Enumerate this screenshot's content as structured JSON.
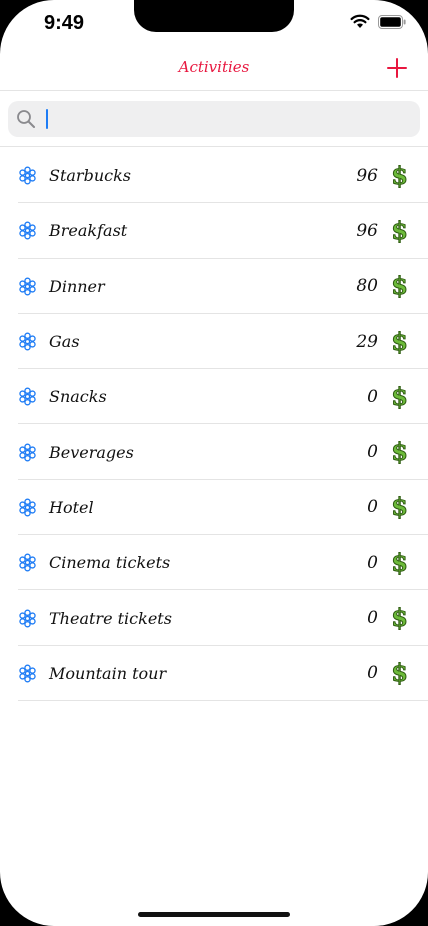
{
  "status_bar": {
    "time": "9:49"
  },
  "nav": {
    "title": "Activities",
    "add_icon": "plus-icon"
  },
  "search": {
    "value": "",
    "placeholder": "",
    "icon": "search-icon"
  },
  "colors": {
    "accent": "#e8173f",
    "row_icon": "#1e7cf5",
    "dollar": "#6dbb3a"
  },
  "activities": [
    {
      "label": "Starbucks",
      "value": "96"
    },
    {
      "label": "Breakfast",
      "value": "96"
    },
    {
      "label": "Dinner",
      "value": "80"
    },
    {
      "label": "Gas",
      "value": "29"
    },
    {
      "label": "Snacks",
      "value": "0"
    },
    {
      "label": "Beverages",
      "value": "0"
    },
    {
      "label": "Hotel",
      "value": "0"
    },
    {
      "label": "Cinema tickets",
      "value": "0"
    },
    {
      "label": "Theatre tickets",
      "value": "0"
    },
    {
      "label": "Mountain tour",
      "value": "0"
    }
  ],
  "row_icon": "flower-icon",
  "row_accessory": {
    "icon": "dollar-icon",
    "glyph": "$"
  }
}
